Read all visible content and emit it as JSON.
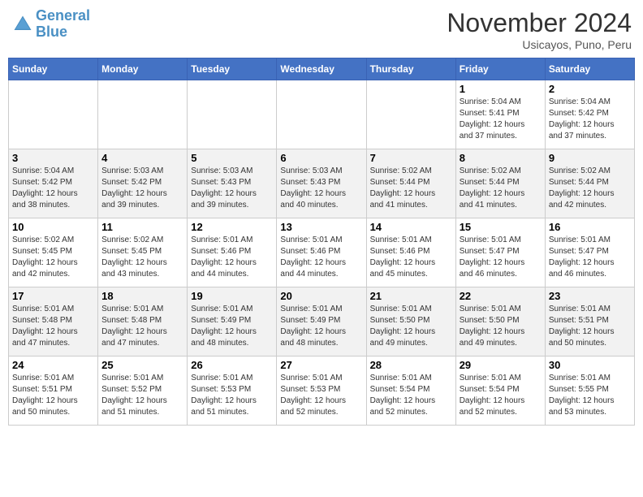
{
  "header": {
    "logo_line1": "General",
    "logo_line2": "Blue",
    "month_title": "November 2024",
    "location": "Usicayos, Puno, Peru"
  },
  "weekdays": [
    "Sunday",
    "Monday",
    "Tuesday",
    "Wednesday",
    "Thursday",
    "Friday",
    "Saturday"
  ],
  "weeks": [
    [
      {
        "day": "",
        "info": ""
      },
      {
        "day": "",
        "info": ""
      },
      {
        "day": "",
        "info": ""
      },
      {
        "day": "",
        "info": ""
      },
      {
        "day": "",
        "info": ""
      },
      {
        "day": "1",
        "info": "Sunrise: 5:04 AM\nSunset: 5:41 PM\nDaylight: 12 hours\nand 37 minutes."
      },
      {
        "day": "2",
        "info": "Sunrise: 5:04 AM\nSunset: 5:42 PM\nDaylight: 12 hours\nand 37 minutes."
      }
    ],
    [
      {
        "day": "3",
        "info": "Sunrise: 5:04 AM\nSunset: 5:42 PM\nDaylight: 12 hours\nand 38 minutes."
      },
      {
        "day": "4",
        "info": "Sunrise: 5:03 AM\nSunset: 5:42 PM\nDaylight: 12 hours\nand 39 minutes."
      },
      {
        "day": "5",
        "info": "Sunrise: 5:03 AM\nSunset: 5:43 PM\nDaylight: 12 hours\nand 39 minutes."
      },
      {
        "day": "6",
        "info": "Sunrise: 5:03 AM\nSunset: 5:43 PM\nDaylight: 12 hours\nand 40 minutes."
      },
      {
        "day": "7",
        "info": "Sunrise: 5:02 AM\nSunset: 5:44 PM\nDaylight: 12 hours\nand 41 minutes."
      },
      {
        "day": "8",
        "info": "Sunrise: 5:02 AM\nSunset: 5:44 PM\nDaylight: 12 hours\nand 41 minutes."
      },
      {
        "day": "9",
        "info": "Sunrise: 5:02 AM\nSunset: 5:44 PM\nDaylight: 12 hours\nand 42 minutes."
      }
    ],
    [
      {
        "day": "10",
        "info": "Sunrise: 5:02 AM\nSunset: 5:45 PM\nDaylight: 12 hours\nand 42 minutes."
      },
      {
        "day": "11",
        "info": "Sunrise: 5:02 AM\nSunset: 5:45 PM\nDaylight: 12 hours\nand 43 minutes."
      },
      {
        "day": "12",
        "info": "Sunrise: 5:01 AM\nSunset: 5:46 PM\nDaylight: 12 hours\nand 44 minutes."
      },
      {
        "day": "13",
        "info": "Sunrise: 5:01 AM\nSunset: 5:46 PM\nDaylight: 12 hours\nand 44 minutes."
      },
      {
        "day": "14",
        "info": "Sunrise: 5:01 AM\nSunset: 5:46 PM\nDaylight: 12 hours\nand 45 minutes."
      },
      {
        "day": "15",
        "info": "Sunrise: 5:01 AM\nSunset: 5:47 PM\nDaylight: 12 hours\nand 46 minutes."
      },
      {
        "day": "16",
        "info": "Sunrise: 5:01 AM\nSunset: 5:47 PM\nDaylight: 12 hours\nand 46 minutes."
      }
    ],
    [
      {
        "day": "17",
        "info": "Sunrise: 5:01 AM\nSunset: 5:48 PM\nDaylight: 12 hours\nand 47 minutes."
      },
      {
        "day": "18",
        "info": "Sunrise: 5:01 AM\nSunset: 5:48 PM\nDaylight: 12 hours\nand 47 minutes."
      },
      {
        "day": "19",
        "info": "Sunrise: 5:01 AM\nSunset: 5:49 PM\nDaylight: 12 hours\nand 48 minutes."
      },
      {
        "day": "20",
        "info": "Sunrise: 5:01 AM\nSunset: 5:49 PM\nDaylight: 12 hours\nand 48 minutes."
      },
      {
        "day": "21",
        "info": "Sunrise: 5:01 AM\nSunset: 5:50 PM\nDaylight: 12 hours\nand 49 minutes."
      },
      {
        "day": "22",
        "info": "Sunrise: 5:01 AM\nSunset: 5:50 PM\nDaylight: 12 hours\nand 49 minutes."
      },
      {
        "day": "23",
        "info": "Sunrise: 5:01 AM\nSunset: 5:51 PM\nDaylight: 12 hours\nand 50 minutes."
      }
    ],
    [
      {
        "day": "24",
        "info": "Sunrise: 5:01 AM\nSunset: 5:51 PM\nDaylight: 12 hours\nand 50 minutes."
      },
      {
        "day": "25",
        "info": "Sunrise: 5:01 AM\nSunset: 5:52 PM\nDaylight: 12 hours\nand 51 minutes."
      },
      {
        "day": "26",
        "info": "Sunrise: 5:01 AM\nSunset: 5:53 PM\nDaylight: 12 hours\nand 51 minutes."
      },
      {
        "day": "27",
        "info": "Sunrise: 5:01 AM\nSunset: 5:53 PM\nDaylight: 12 hours\nand 52 minutes."
      },
      {
        "day": "28",
        "info": "Sunrise: 5:01 AM\nSunset: 5:54 PM\nDaylight: 12 hours\nand 52 minutes."
      },
      {
        "day": "29",
        "info": "Sunrise: 5:01 AM\nSunset: 5:54 PM\nDaylight: 12 hours\nand 52 minutes."
      },
      {
        "day": "30",
        "info": "Sunrise: 5:01 AM\nSunset: 5:55 PM\nDaylight: 12 hours\nand 53 minutes."
      }
    ]
  ]
}
